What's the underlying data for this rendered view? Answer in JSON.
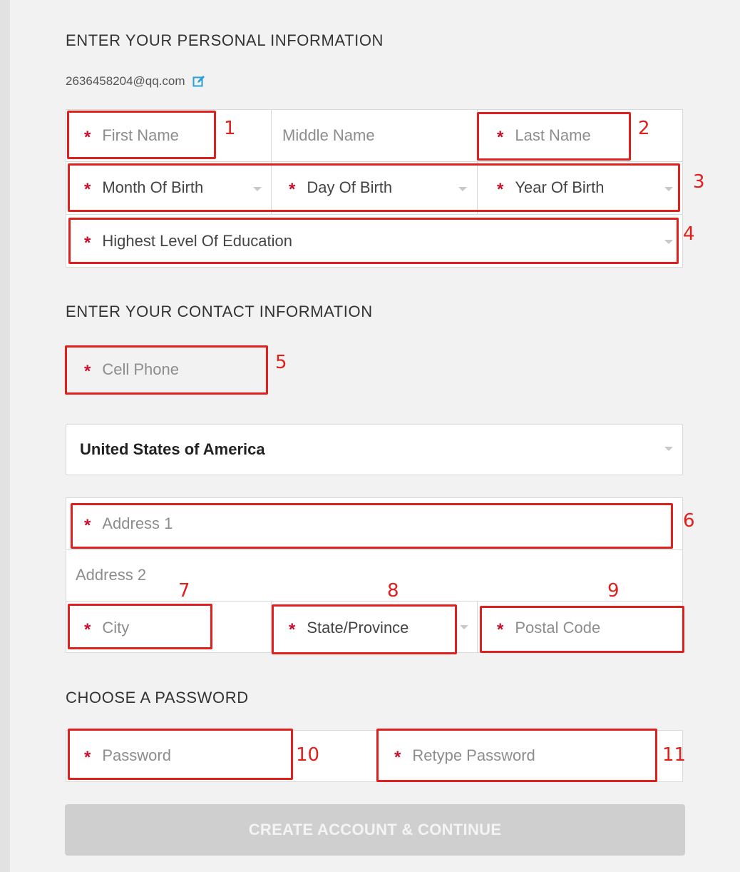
{
  "personal": {
    "title": "ENTER YOUR PERSONAL INFORMATION",
    "email": "2636458204@qq.com",
    "first_name": "First Name",
    "middle_name": "Middle Name",
    "last_name": "Last Name",
    "month_of_birth": "Month Of Birth",
    "day_of_birth": "Day Of Birth",
    "year_of_birth": "Year Of Birth",
    "education": "Highest Level Of Education"
  },
  "contact": {
    "title": "ENTER YOUR CONTACT INFORMATION",
    "cell_phone": "Cell Phone",
    "country": "United States of America",
    "address1": "Address 1",
    "address2": "Address 2",
    "city": "City",
    "state": "State/Province",
    "postal": "Postal Code"
  },
  "password": {
    "title": "CHOOSE A PASSWORD",
    "password": "Password",
    "retype": "Retype Password"
  },
  "cta_label": "CREATE ACCOUNT & CONTINUE",
  "annotations": [
    "1",
    "2",
    "3",
    "4",
    "5",
    "6",
    "7",
    "8",
    "9",
    "10",
    "11"
  ],
  "required_mark": "*",
  "colors": {
    "required": "#c8102e",
    "annotation": "#e0201c",
    "cta_disabled": "#cfcfcf"
  }
}
